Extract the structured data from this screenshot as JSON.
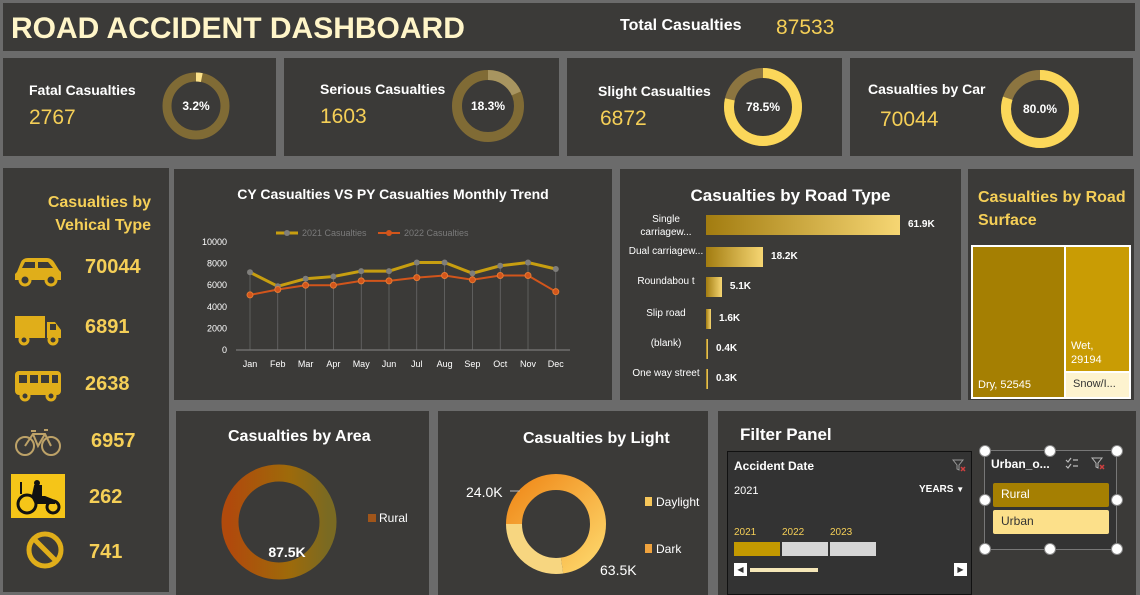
{
  "header": {
    "title": "ROAD ACCIDENT DASHBOARD",
    "total_label": "Total Casualties",
    "total_value": "87533"
  },
  "kpis": [
    {
      "label": "Fatal Casualties",
      "value": "2767",
      "pct": "3.2%",
      "fraction": 0.032
    },
    {
      "label": "Serious Casualties",
      "value": "1603",
      "pct": "18.3%",
      "fraction": 0.183
    },
    {
      "label": "Slight Casualties",
      "value": "6872",
      "pct": "78.5%",
      "fraction": 0.785
    },
    {
      "label": "Casualties by Car",
      "value": "70044",
      "pct": "80.0%",
      "fraction": 0.8
    }
  ],
  "vehicles": {
    "title": "Casualties by Vehical Type",
    "items": [
      {
        "icon": "car-icon",
        "value": "70044"
      },
      {
        "icon": "truck-icon",
        "value": "6891"
      },
      {
        "icon": "bus-icon",
        "value": "2638"
      },
      {
        "icon": "bicycle-icon",
        "value": "6957"
      },
      {
        "icon": "tractor-icon",
        "value": "262"
      },
      {
        "icon": "prohibited-icon",
        "value": "741"
      }
    ]
  },
  "trend": {
    "title": "CY Casualties VS PY Casualties Monthly Trend",
    "legend": [
      "2021 Casualties",
      "2022 Casualties"
    ],
    "months": [
      "Jan",
      "Feb",
      "Mar",
      "Apr",
      "May",
      "Jun",
      "Jul",
      "Aug",
      "Sep",
      "Oct",
      "Nov",
      "Dec"
    ],
    "y_ticks": [
      "10000",
      "8000",
      "6000",
      "4000",
      "2000",
      "0"
    ]
  },
  "chart_data": [
    {
      "type": "line",
      "title": "CY Casualties VS PY Casualties Monthly Trend",
      "categories": [
        "Jan",
        "Feb",
        "Mar",
        "Apr",
        "May",
        "Jun",
        "Jul",
        "Aug",
        "Sep",
        "Oct",
        "Nov",
        "Dec"
      ],
      "ylim": [
        0,
        10000
      ],
      "grid": false,
      "legend": "top",
      "series": [
        {
          "name": "2021 Casualties",
          "color": "#c79e10",
          "values": [
            7200,
            5900,
            6600,
            6800,
            7300,
            7300,
            8100,
            8100,
            7100,
            7800,
            8100,
            7500
          ]
        },
        {
          "name": "2022 Casualties",
          "color": "#d2551b",
          "values": [
            5100,
            5600,
            6000,
            6000,
            6400,
            6400,
            6700,
            6900,
            6500,
            6900,
            6900,
            5400
          ]
        }
      ]
    },
    {
      "type": "bar",
      "title": "Casualties by Road Type",
      "categories": [
        "Single carriagew...",
        "Dual carriagew...",
        "Roundabou t",
        "Slip road",
        "(blank)",
        "One way street"
      ],
      "values": [
        61900,
        18200,
        5100,
        1600,
        400,
        300
      ],
      "labels": [
        "61.9K",
        "18.2K",
        "5.1K",
        "1.6K",
        "0.4K",
        "0.3K"
      ]
    },
    {
      "type": "heatmap",
      "title": "Casualties by Road Surface",
      "categories": [
        "Dry",
        "Wet",
        "Snow/I..."
      ],
      "values": [
        52545,
        29194,
        5794
      ]
    },
    {
      "type": "pie",
      "title": "Casualties by Area",
      "categories": [
        "Rural"
      ],
      "values": [
        87500
      ],
      "labels": [
        "87.5K"
      ]
    },
    {
      "type": "pie",
      "title": "Casualties by Light",
      "categories": [
        "Daylight",
        "Dark"
      ],
      "values": [
        63500,
        24000
      ],
      "labels": [
        "63.5K",
        "24.0K"
      ]
    }
  ],
  "road_type": {
    "title": "Casualties by Road Type",
    "rows": [
      {
        "label": "Single carriagew...",
        "value": "61.9K",
        "fraction": 1.0
      },
      {
        "label": "Dual carriagew...",
        "value": "18.2K",
        "fraction": 0.294
      },
      {
        "label": "Roundabou t",
        "value": "5.1K",
        "fraction": 0.082
      },
      {
        "label": "Slip road",
        "value": "1.6K",
        "fraction": 0.026
      },
      {
        "label": "(blank)",
        "value": "0.4K",
        "fraction": 0.006
      },
      {
        "label": "One way street",
        "value": "0.3K",
        "fraction": 0.005
      }
    ]
  },
  "surface": {
    "title": "Casualties by Road Surface",
    "dry": "Dry, 52545",
    "wet": "Wet, 29194",
    "snow": "Snow/I..."
  },
  "area": {
    "title": "Casualties by Area",
    "legend": "Rural",
    "value": "87.5K"
  },
  "light": {
    "title": "Casualties by Light",
    "legend": [
      "Daylight",
      "Dark"
    ],
    "dark_value": "24.0K",
    "day_value": "63.5K"
  },
  "filter": {
    "title": "Filter Panel",
    "timeline_header": "Accident Date",
    "selected_year": "2021",
    "period": "YEARS",
    "years": [
      "2021",
      "2022",
      "2023"
    ],
    "slicer_header": "Urban_o...",
    "options": [
      "Rural",
      "Urban"
    ]
  },
  "colors": {
    "accent": "#f5cf57",
    "panel": "#3b3a38",
    "background": "#6b6b6b",
    "dark_gold": "#a27c10"
  }
}
